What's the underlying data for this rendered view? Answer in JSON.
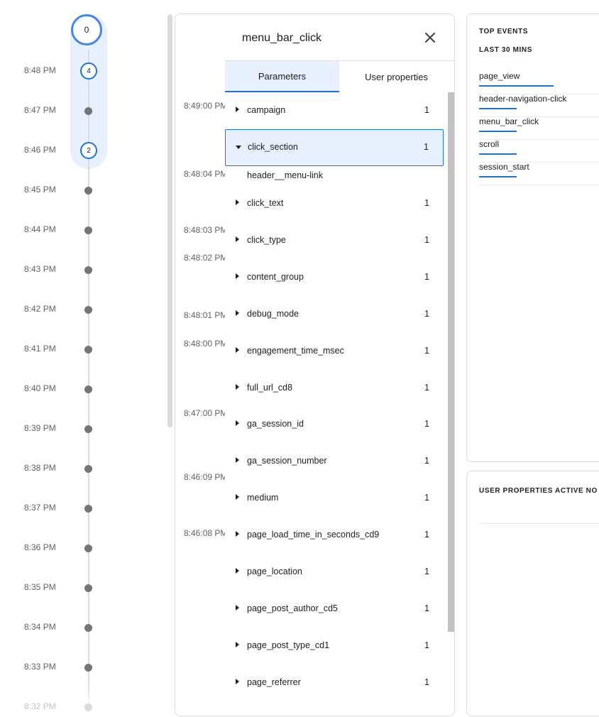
{
  "timeline": {
    "top_count": "0",
    "rows": [
      {
        "time": "8:48 PM",
        "count": "4"
      },
      {
        "time": "8:47 PM"
      },
      {
        "time": "8:46 PM",
        "count": "2"
      },
      {
        "time": "8:45 PM"
      },
      {
        "time": "8:44 PM"
      },
      {
        "time": "8:43 PM"
      },
      {
        "time": "8:42 PM"
      },
      {
        "time": "8:41 PM"
      },
      {
        "time": "8:40 PM"
      },
      {
        "time": "8:39 PM"
      },
      {
        "time": "8:38 PM"
      },
      {
        "time": "8:37 PM"
      },
      {
        "time": "8:36 PM"
      },
      {
        "time": "8:35 PM"
      },
      {
        "time": "8:34 PM"
      },
      {
        "time": "8:33 PM"
      },
      {
        "time": "8:32 PM"
      }
    ]
  },
  "event_panel": {
    "title": "menu_bar_click",
    "tabs": [
      "Parameters",
      "User properties"
    ],
    "timestamps": [
      "8:49:00 PM",
      "8:48:04 PM",
      "8:48:03 PM",
      "8:48:02 PM",
      "8:48:01 PM",
      "8:48:00 PM",
      "8:47:00 PM",
      "8:46:09 PM",
      "8:46:08 PM"
    ],
    "expanded_value": "header__menu-link",
    "params": [
      {
        "name": "campaign",
        "count": "1"
      },
      {
        "name": "click_section",
        "count": "1"
      },
      {
        "name": "click_text",
        "count": "1"
      },
      {
        "name": "click_type",
        "count": "1"
      },
      {
        "name": "content_group",
        "count": "1"
      },
      {
        "name": "debug_mode",
        "count": "1"
      },
      {
        "name": "engagement_time_msec",
        "count": "1"
      },
      {
        "name": "full_url_cd8",
        "count": "1"
      },
      {
        "name": "ga_session_id",
        "count": "1"
      },
      {
        "name": "ga_session_number",
        "count": "1"
      },
      {
        "name": "medium",
        "count": "1"
      },
      {
        "name": "page_load_time_in_seconds_cd9",
        "count": "1"
      },
      {
        "name": "page_location",
        "count": "1"
      },
      {
        "name": "page_post_author_cd5",
        "count": "1"
      },
      {
        "name": "page_post_type_cd1",
        "count": "1"
      },
      {
        "name": "page_referrer",
        "count": "1"
      }
    ]
  },
  "top_events": {
    "heading": "TOP EVENTS",
    "subheading": "LAST 30 MINS",
    "items": [
      {
        "name": "page_view",
        "share": 0.62
      },
      {
        "name": "header-navigation-click",
        "share": 0.31
      },
      {
        "name": "menu_bar_click",
        "share": 0.31
      },
      {
        "name": "scroll",
        "share": 0.31
      },
      {
        "name": "session_start",
        "share": 0.31
      }
    ]
  },
  "user_properties": {
    "heading": "USER PROPERTIES ACTIVE NO"
  },
  "colors": {
    "accent": "#1a73e8",
    "highlight": "#e8f0fe",
    "dot": "#70757a"
  }
}
